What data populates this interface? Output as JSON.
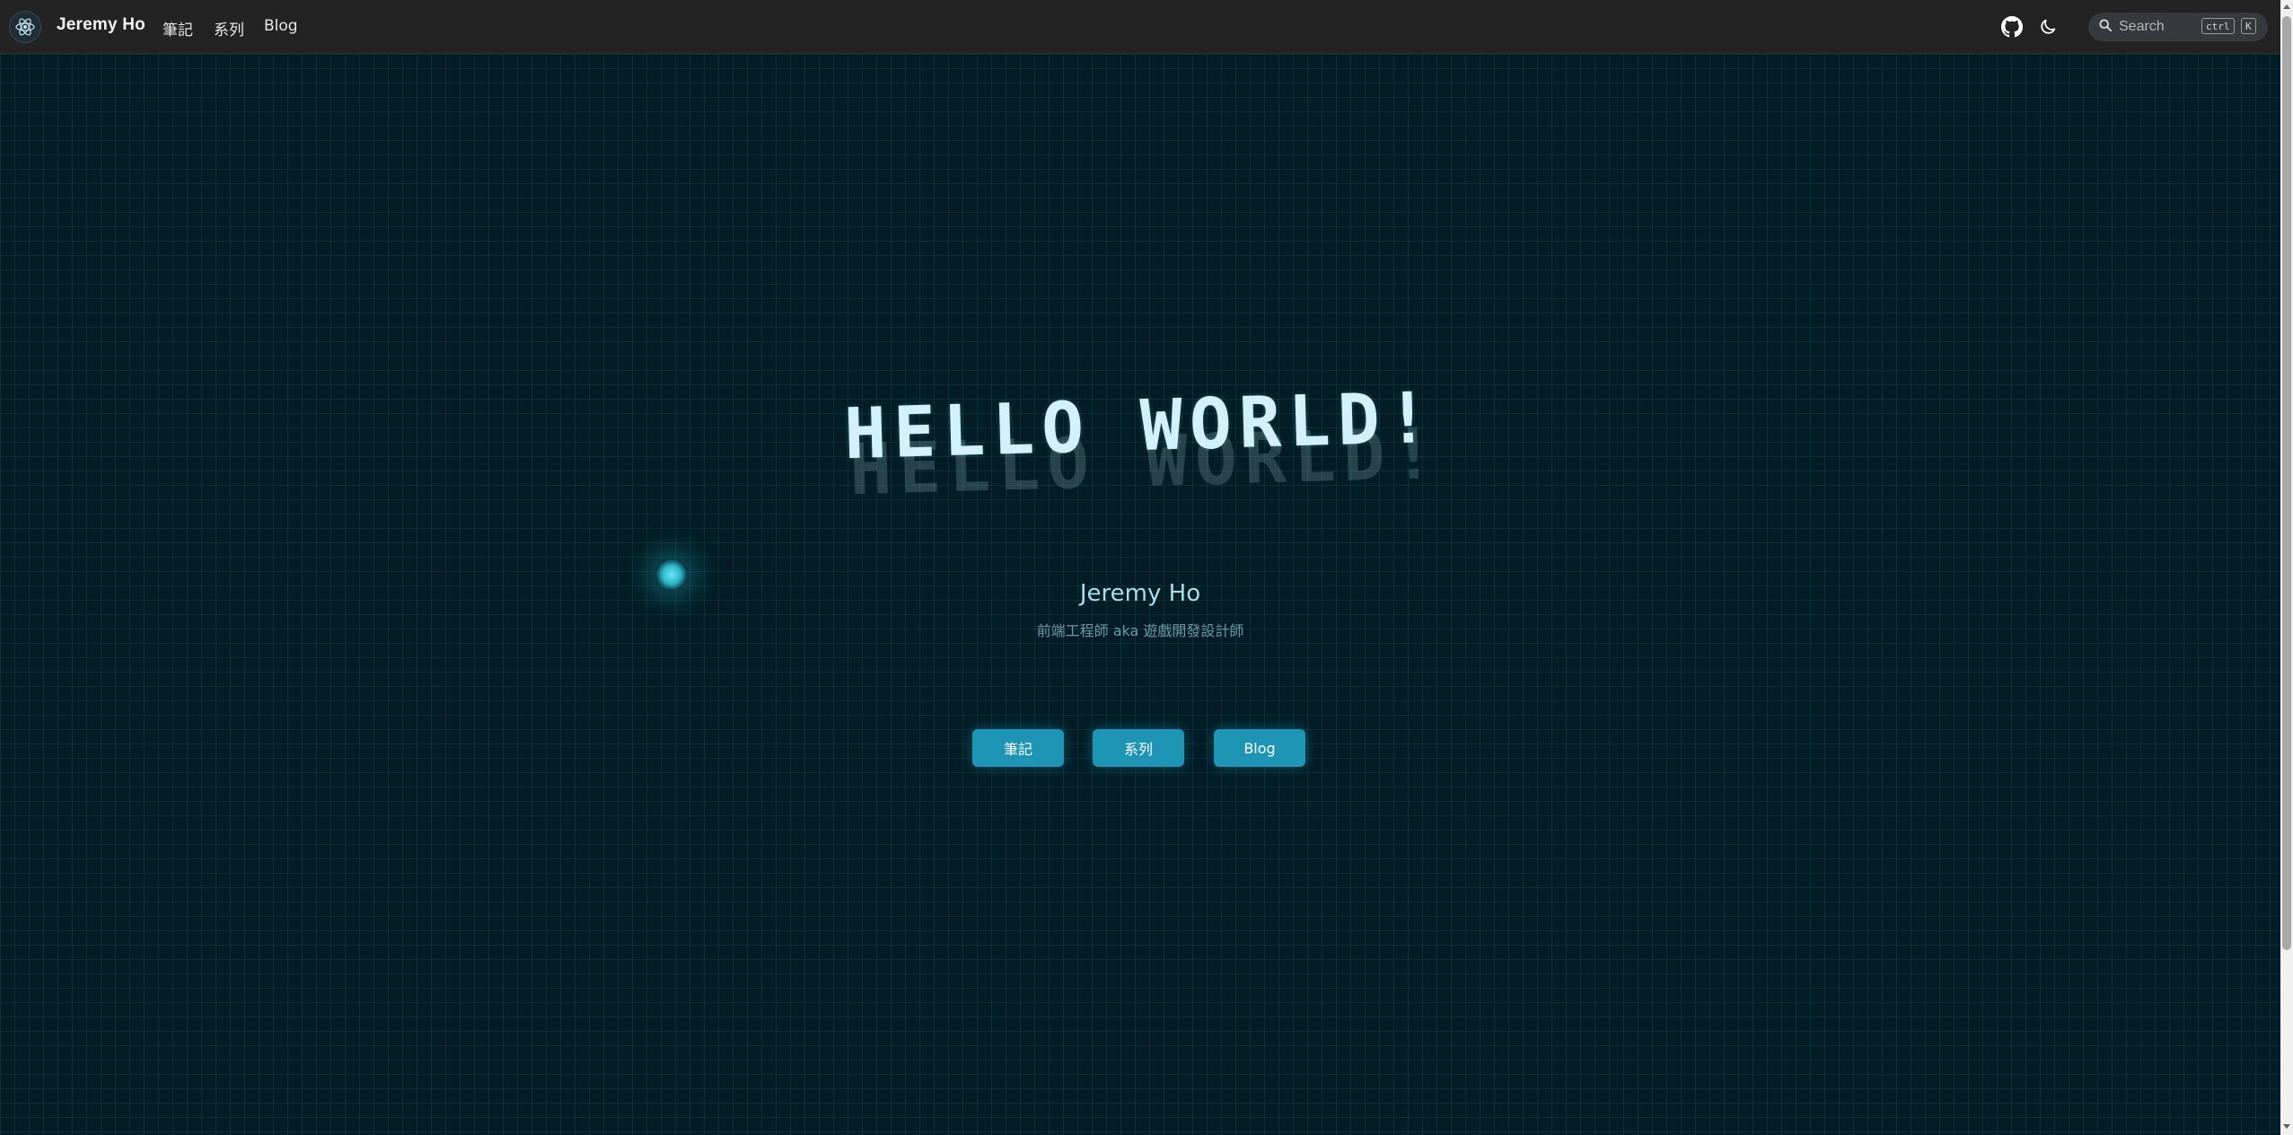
{
  "navbar": {
    "brand": "Jeremy Ho",
    "links": [
      "筆記",
      "系列",
      "Blog"
    ],
    "icons": {
      "logo": "atom-logo-icon",
      "github": "github-icon",
      "theme": "moon-icon",
      "search": "search-icon"
    },
    "search": {
      "label": "Search",
      "shortcut_keys": [
        "ctrl",
        "K"
      ]
    }
  },
  "hero": {
    "title": "HELLO WORLD!",
    "name": "Jeremy Ho",
    "tagline": "前端工程師 aka 遊戲開發設計師",
    "buttons": [
      "筆記",
      "系列",
      "Blog"
    ]
  },
  "colors": {
    "background": "#031c25",
    "grid": "#286e78",
    "navbar": "#232323",
    "accent": "#1f95b5",
    "title": "#d4f1fb",
    "name": "#a6def0"
  }
}
